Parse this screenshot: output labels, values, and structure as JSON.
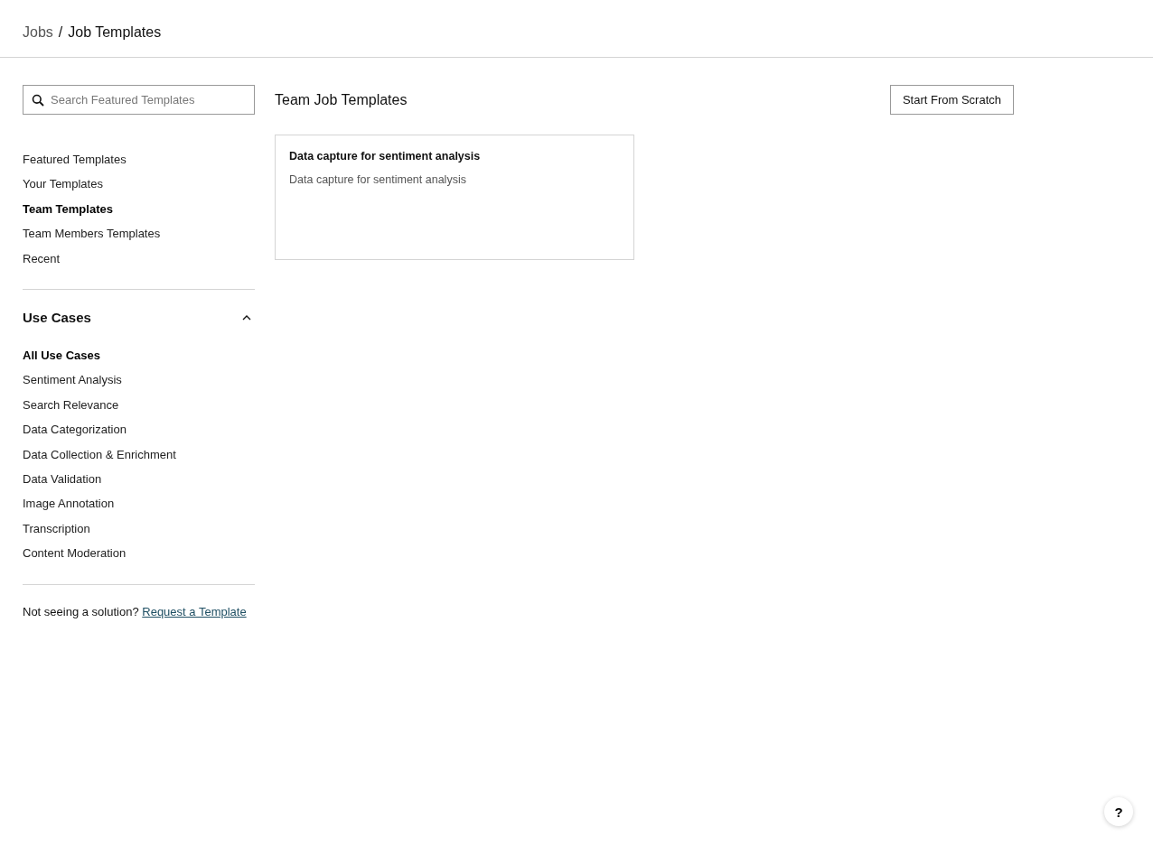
{
  "breadcrumb": [
    {
      "label": "Jobs",
      "kind": "link"
    },
    {
      "label": "/",
      "kind": "separator"
    },
    {
      "label": "Job Templates",
      "kind": "current"
    }
  ],
  "search": {
    "placeholder": "Search Featured Templates"
  },
  "template_nav": [
    {
      "label": "Featured Templates",
      "selected": false
    },
    {
      "label": "Your Templates",
      "selected": false
    },
    {
      "label": "Team Templates",
      "selected": true
    },
    {
      "label": "Team Members Templates",
      "selected": false
    },
    {
      "label": "Recent",
      "selected": false
    }
  ],
  "use_cases": {
    "title": "Use Cases",
    "expanded": true,
    "items": [
      {
        "label": "All Use Cases",
        "selected": true
      },
      {
        "label": "Sentiment Analysis",
        "selected": false
      },
      {
        "label": "Search Relevance",
        "selected": false
      },
      {
        "label": "Data Categorization",
        "selected": false
      },
      {
        "label": "Data Collection & Enrichment",
        "selected": false
      },
      {
        "label": "Data Validation",
        "selected": false
      },
      {
        "label": "Image Annotation",
        "selected": false
      },
      {
        "label": "Transcription",
        "selected": false
      },
      {
        "label": "Content Moderation",
        "selected": false
      }
    ]
  },
  "footer_note": {
    "text": "Not seeing a solution?",
    "link": "Request a Template"
  },
  "main": {
    "title": "Team Job Templates",
    "action": "Start From Scratch",
    "cards": [
      {
        "title": "Data capture for sentiment analysis",
        "description": "Data capture for sentiment analysis"
      }
    ]
  },
  "help_button": "?"
}
